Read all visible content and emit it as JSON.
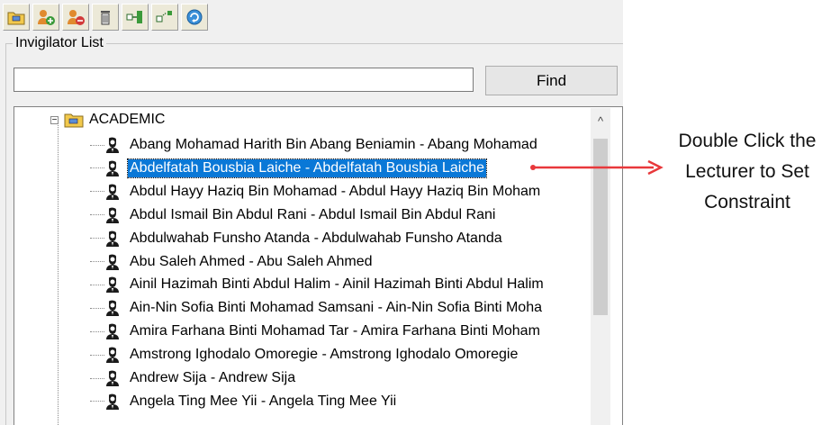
{
  "toolbar": {
    "buttons": [
      {
        "icon": "folder-icon"
      },
      {
        "icon": "add-user-icon"
      },
      {
        "icon": "remove-user-icon"
      },
      {
        "icon": "trash-icon"
      },
      {
        "icon": "link-icon"
      },
      {
        "icon": "unlink-icon"
      },
      {
        "icon": "refresh-icon"
      }
    ]
  },
  "group": {
    "label": "Invigilator List"
  },
  "search": {
    "value": "",
    "placeholder": ""
  },
  "find_button": {
    "label": "Find"
  },
  "tree": {
    "root_label": "ACADEMIC",
    "expander": "−",
    "items": [
      {
        "label": "Abang Mohamad Harith Bin Abang Beniamin - Abang Mohamad",
        "selected": false
      },
      {
        "label": "Abdelfatah Bousbia Laiche - Abdelfatah Bousbia Laiche",
        "selected": true
      },
      {
        "label": "Abdul Hayy Haziq Bin Mohamad - Abdul Hayy Haziq Bin Moham",
        "selected": false
      },
      {
        "label": "Abdul Ismail Bin Abdul Rani - Abdul Ismail Bin Abdul Rani",
        "selected": false
      },
      {
        "label": "Abdulwahab Funsho Atanda - Abdulwahab Funsho Atanda",
        "selected": false
      },
      {
        "label": "Abu Saleh Ahmed - Abu Saleh Ahmed",
        "selected": false
      },
      {
        "label": "Ainil Hazimah Binti Abdul Halim - Ainil Hazimah Binti Abdul Halim",
        "selected": false
      },
      {
        "label": "Ain-Nin Sofia Binti Mohamad Samsani - Ain-Nin Sofia Binti Moha",
        "selected": false
      },
      {
        "label": "Amira Farhana Binti Mohamad Tar - Amira Farhana Binti Moham",
        "selected": false
      },
      {
        "label": "Amstrong Ighodalo Omoregie - Amstrong Ighodalo Omoregie",
        "selected": false
      },
      {
        "label": "Andrew Sija - Andrew Sija",
        "selected": false
      },
      {
        "label": "Angela Ting Mee Yii - Angela Ting Mee Yii",
        "selected": false
      }
    ]
  },
  "scrollbar": {
    "up_arrow": "^"
  },
  "annotation": {
    "lines": [
      "Double Click the",
      "Lecturer to Set",
      "Constraint"
    ],
    "arrow_color": "#e8383b"
  },
  "colors": {
    "selection": "#0a78d7"
  }
}
